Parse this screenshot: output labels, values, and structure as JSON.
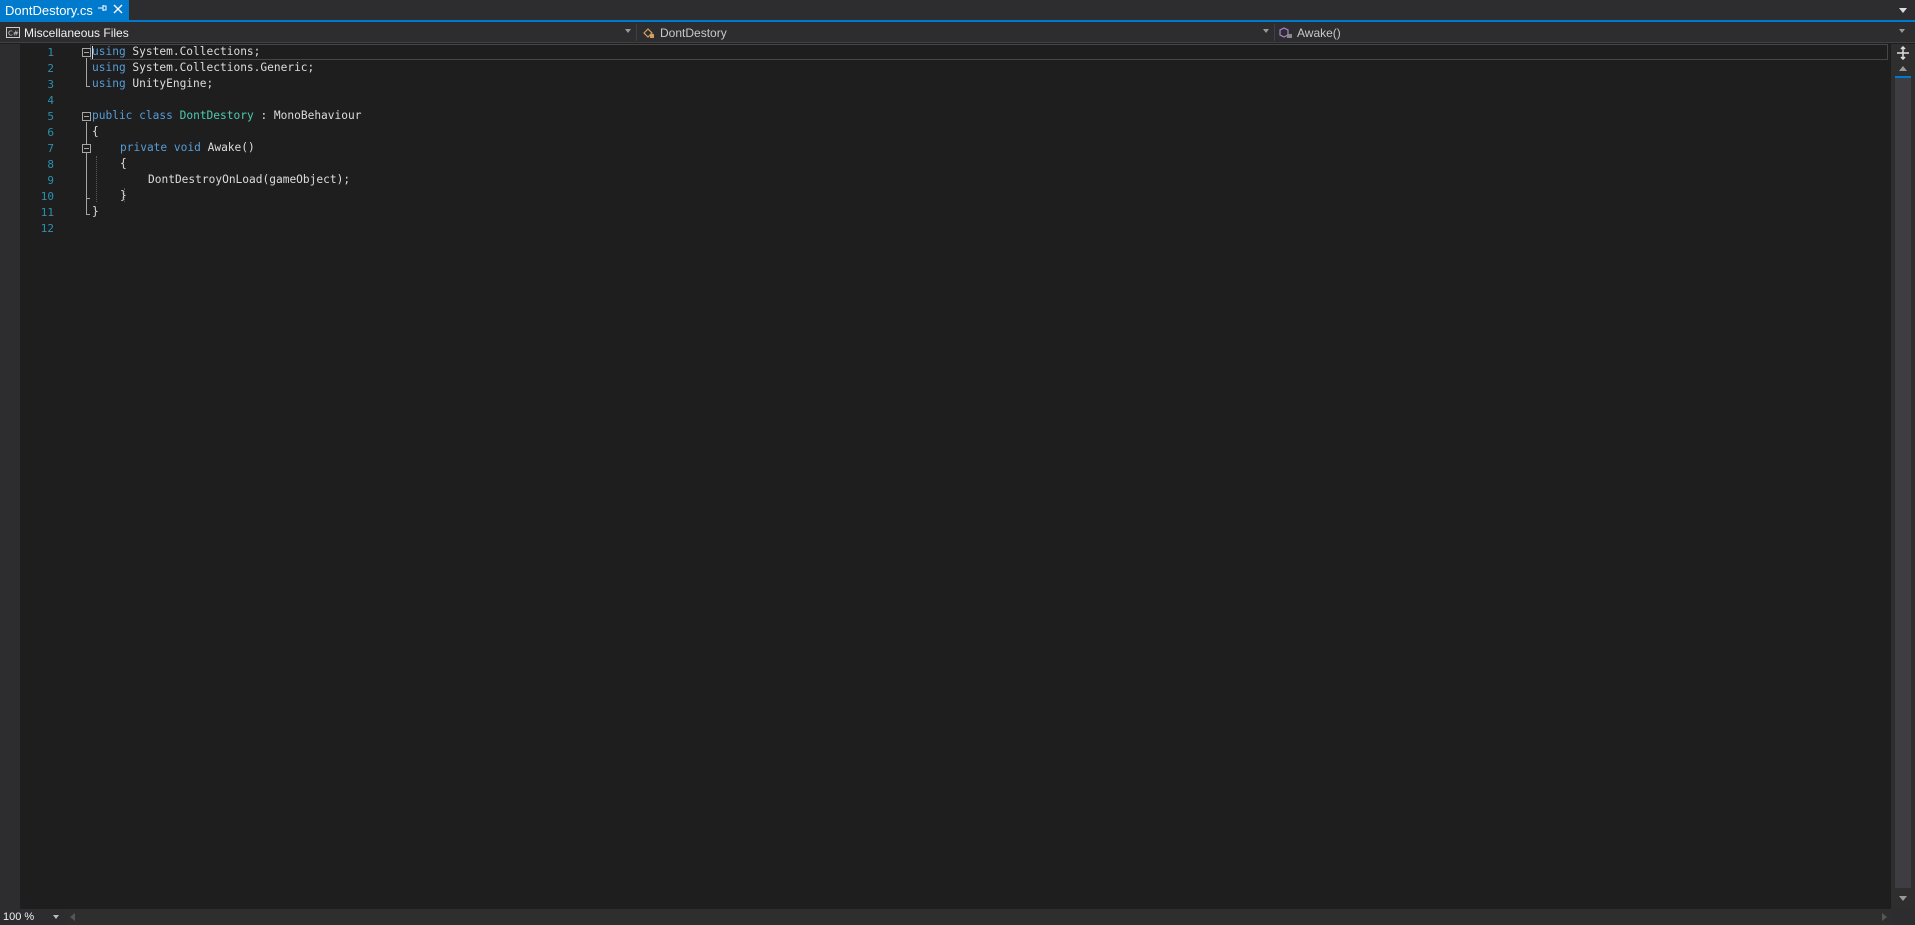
{
  "tab": {
    "title": "DontDestory.cs",
    "pin_icon": "pin-icon",
    "close_icon": "close-icon"
  },
  "navbar": {
    "project": "Miscellaneous Files",
    "type": "DontDestory",
    "member": "Awake()"
  },
  "editor": {
    "line_numbers": [
      "1",
      "2",
      "3",
      "4",
      "5",
      "6",
      "7",
      "8",
      "9",
      "10",
      "11",
      "12"
    ],
    "lines": {
      "l1_kw": "using",
      "l1_rest": " System.Collections;",
      "l2_kw": "using",
      "l2_rest": " System.Collections.Generic;",
      "l3_kw": "using",
      "l3_rest": " UnityEngine;",
      "l5_kw1": "public",
      "l5_kw2": "class",
      "l5_type": "DontDestory",
      "l5_rest": " : MonoBehaviour",
      "l6": "{",
      "l7_kw1": "private",
      "l7_kw2": "void",
      "l7_rest": " Awake()",
      "l8": "{",
      "l9": "DontDestroyOnLoad(gameObject);",
      "l10": "}",
      "l11": "}"
    }
  },
  "status": {
    "zoom": "100 %"
  },
  "colors": {
    "accent": "#007acc",
    "keyword": "#569cd6",
    "type": "#4ec9b0",
    "line_number": "#2b91af",
    "background": "#1e1e1e"
  }
}
